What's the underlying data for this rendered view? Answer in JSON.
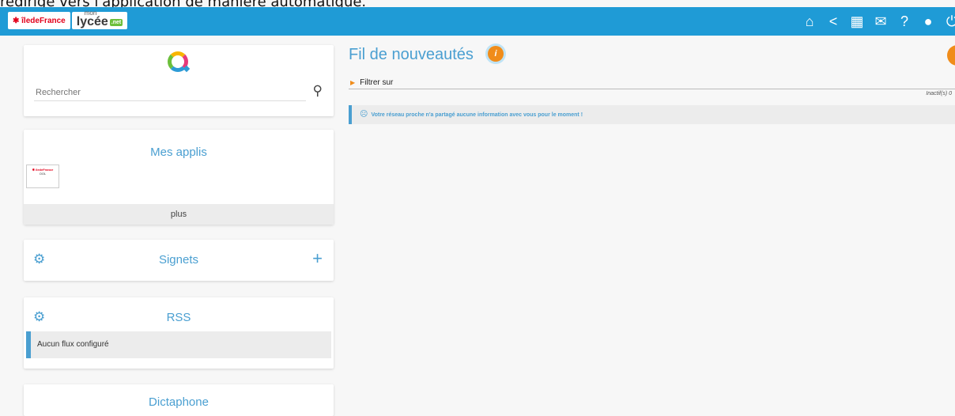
{
  "page_caption": "redirige vers l'application de manière automatique.",
  "topbar": {
    "logo_region": "✱ îledeFrance",
    "logo_mon": "mon",
    "logo_lycee": "lycée",
    "logo_net": ".net",
    "icons": [
      "home-icon",
      "share-icon",
      "apps-grid-icon",
      "mail-icon",
      "help-icon",
      "user-icon",
      "power-icon"
    ],
    "accent_color": "#1f9bd6"
  },
  "search": {
    "placeholder": "Rechercher"
  },
  "apps": {
    "title": "Mes applis",
    "tile_line1": "✱ îledeFrance",
    "tile_line2": "OOL",
    "more_label": "plus"
  },
  "signets": {
    "title": "Signets",
    "add_symbol": "+"
  },
  "rss": {
    "title": "RSS",
    "empty_text": "Aucun flux configuré"
  },
  "dictaphone": {
    "title": "Dictaphone"
  },
  "feed": {
    "title": "Fil de nouveautés",
    "info_symbol": "i",
    "filter_label": "Filtrer sur",
    "inactive_label": "Inactif(s) 0",
    "notice_text": "Votre réseau proche n'a partagé aucune information avec vous pour le moment !"
  }
}
